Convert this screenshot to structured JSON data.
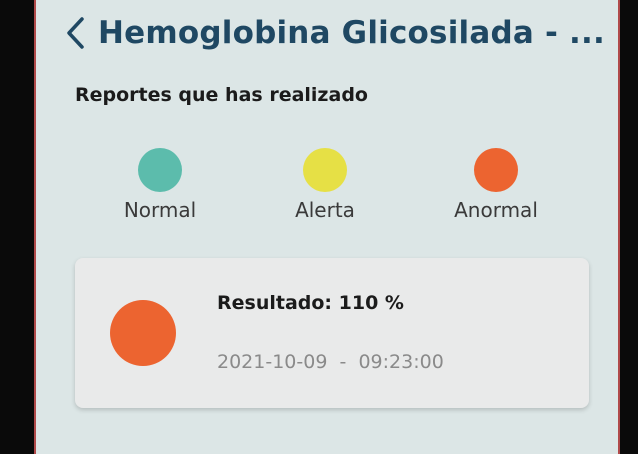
{
  "header": {
    "title": "Hemoglobina Glicosilada - ..."
  },
  "subtitle": "Reportes que has realizado",
  "legend": [
    {
      "label": "Normal",
      "color": "#5cbcac"
    },
    {
      "label": "Alerta",
      "color": "#e6e045"
    },
    {
      "label": "Anormal",
      "color": "#ec6430"
    }
  ],
  "report": {
    "label": "Resultado:",
    "value": "110 %",
    "date": "2021-10-09",
    "separator": "-",
    "time": "09:23:00",
    "status_color": "#ec6430"
  }
}
